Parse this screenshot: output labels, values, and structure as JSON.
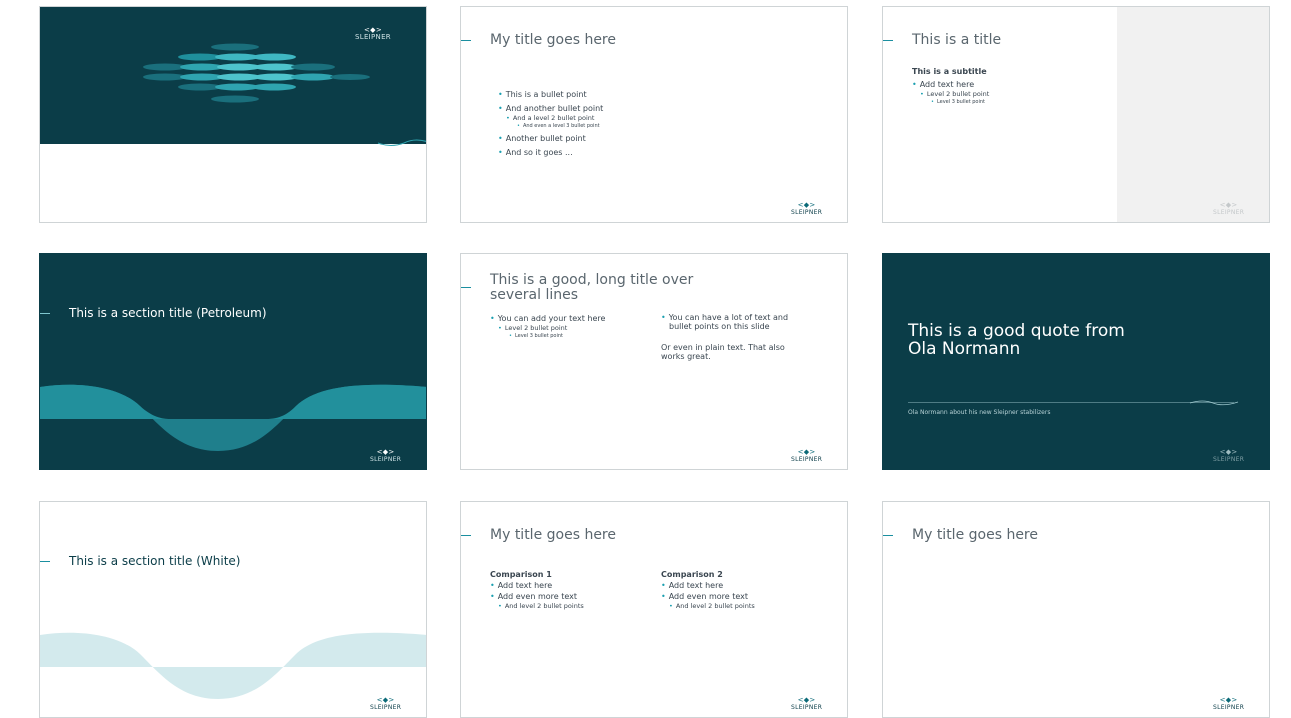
{
  "brand": {
    "logo_text": "SLEIPNER",
    "primary": "#0b3d48",
    "accent": "#1a9fb0",
    "light_wave": "#d3eaed"
  },
  "slides": {
    "s1": {
      "logo": "SLEIPNER"
    },
    "s2": {
      "title": "My title goes here",
      "b1": "This is a bullet point",
      "b2": "And another bullet point",
      "b3": "And a level 2 bullet point",
      "b4": "And even a level 3 bullet point",
      "b5": "Another bullet point",
      "b6": "And so it goes ...",
      "logo": "SLEIPNER"
    },
    "s3": {
      "title": "This is a title",
      "subtitle": "This is a subtitle",
      "b1": "Add text here",
      "b2": "Level 2 bullet point",
      "b3": "Level 3 bullet point",
      "logo": "SLEIPNER"
    },
    "s4": {
      "title": "This is a section title (Petroleum)",
      "logo": "SLEIPNER"
    },
    "s5": {
      "title_line1": "This is a good, long title over",
      "title_line2": "several lines",
      "left_b1": "You can add your text here",
      "left_b2": "Level 2 bullet point",
      "left_b3": "Level 3 bullet point",
      "right_b1_line1": "You can have a lot of text and",
      "right_b1_line2": "bullet points on this slide",
      "right_plain_line1": "Or even in plain text. That also",
      "right_plain_line2": "works great.",
      "logo": "SLEIPNER"
    },
    "s6": {
      "quote_line1": "This is a good quote from",
      "quote_line2": "Ola Normann",
      "caption": "Ola Normann about his new Sleipner stabilizers",
      "logo": "SLEIPNER"
    },
    "s7": {
      "title": "This is a section title (White)",
      "logo": "SLEIPNER"
    },
    "s8": {
      "title": "My title goes here",
      "col1_head": "Comparison 1",
      "col1_b1": "Add text here",
      "col1_b2": "Add even more text",
      "col1_b3": "And level 2 bullet points",
      "col2_head": "Comparison 2",
      "col2_b1": "Add text here",
      "col2_b2": "Add even more text",
      "col2_b3": "And level 2 bullet points",
      "logo": "SLEIPNER"
    },
    "s9": {
      "title": "My title goes here",
      "logo": "SLEIPNER"
    }
  }
}
